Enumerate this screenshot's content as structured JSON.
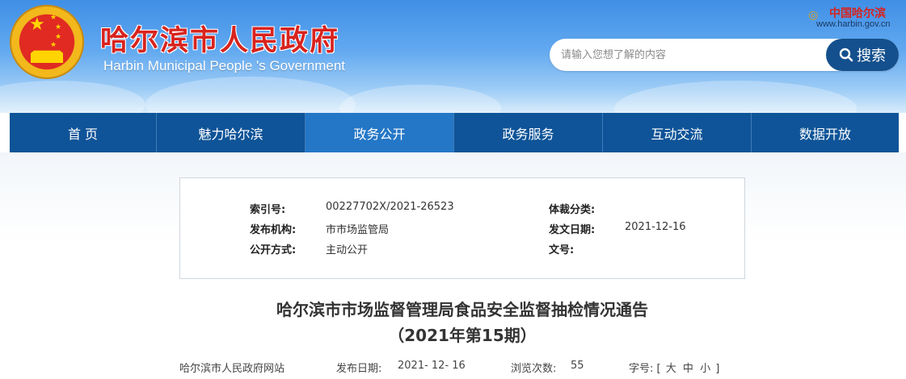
{
  "header": {
    "title": "哈尔滨市人民政府",
    "subtitle": "Harbin Municipal People 's Government",
    "brand": "中国哈尔滨",
    "url": "www.harbin.gov.cn",
    "search": {
      "placeholder": "请输入您想了解的内容",
      "value": "",
      "button_label": "搜索"
    }
  },
  "nav": {
    "items": [
      {
        "label": "首 页"
      },
      {
        "label": "魅力哈尔滨"
      },
      {
        "label": "政务公开",
        "active": true
      },
      {
        "label": "政务服务"
      },
      {
        "label": "互动交流"
      },
      {
        "label": "数据开放"
      }
    ]
  },
  "meta": {
    "index_label": "索引号:",
    "index_value": "00227702X/2021-26523",
    "category_label": "体裁分类:",
    "category_value": "",
    "publisher_label": "发布机构:",
    "publisher_value": "市市场监管局",
    "issue_date_label": "发文日期:",
    "issue_date_value": "2021-12-16",
    "disclosure_label": "公开方式:",
    "disclosure_value": "主动公开",
    "doc_no_label": "文号:",
    "doc_no_value": ""
  },
  "article": {
    "title_line1": "哈尔滨市市场监督管理局食品安全监督抽检情况通告",
    "title_line2": "（2021年第15期）",
    "source": "哈尔滨市人民政府网站",
    "publish_date_label": "发布日期:",
    "publish_date_value": "2021- 12- 16",
    "views_label": "浏览次数:",
    "views_value": "55",
    "font_size_label": "字号:",
    "font_size_open": "[",
    "font_size_large": "大",
    "font_size_medium": "中",
    "font_size_small": "小",
    "font_size_close": "]"
  },
  "colors": {
    "nav_bg": "#0f5498",
    "nav_active": "#2477c6",
    "title_red": "#d8231e",
    "search_button": "#14508d"
  }
}
